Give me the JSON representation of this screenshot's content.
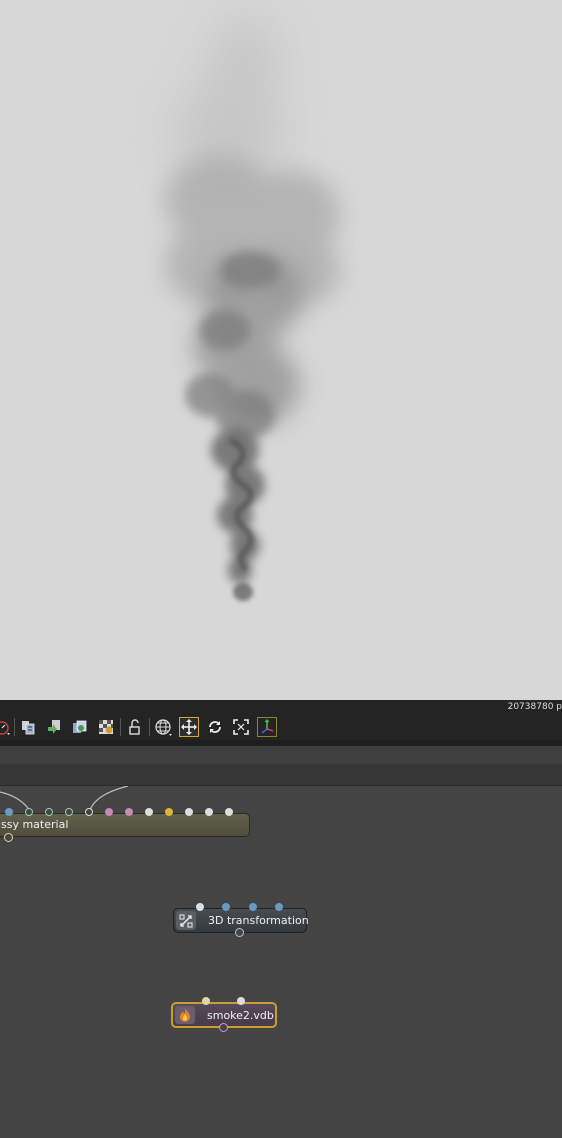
{
  "viewport": {
    "stats_text": "20738780 p"
  },
  "toolbar": {
    "icons": [
      "render-statistics-icon",
      "copy-icon",
      "paste-icon",
      "duplicate-icon",
      "checkerboard-icon",
      "lock-icon",
      "world-globe-icon",
      "move-icon",
      "rotate-icon",
      "fit-view-icon",
      "axis-gizmo-icon"
    ]
  },
  "graph": {
    "nodes": {
      "material": {
        "label": "ssy material"
      },
      "transform": {
        "label": "3D transformation"
      },
      "vdb": {
        "label": "smoke2.vdb"
      }
    }
  },
  "colors": {
    "viewport_bg": "#d7d7d7",
    "toolbar_bg": "#242424",
    "graph_bg": "#444444",
    "material_node": "#5b5a48",
    "transform_node": "#3b3f44",
    "vdb_node": "#4d4350",
    "vdb_border": "#c8a030",
    "active_tool_border": "#d4a82a"
  }
}
